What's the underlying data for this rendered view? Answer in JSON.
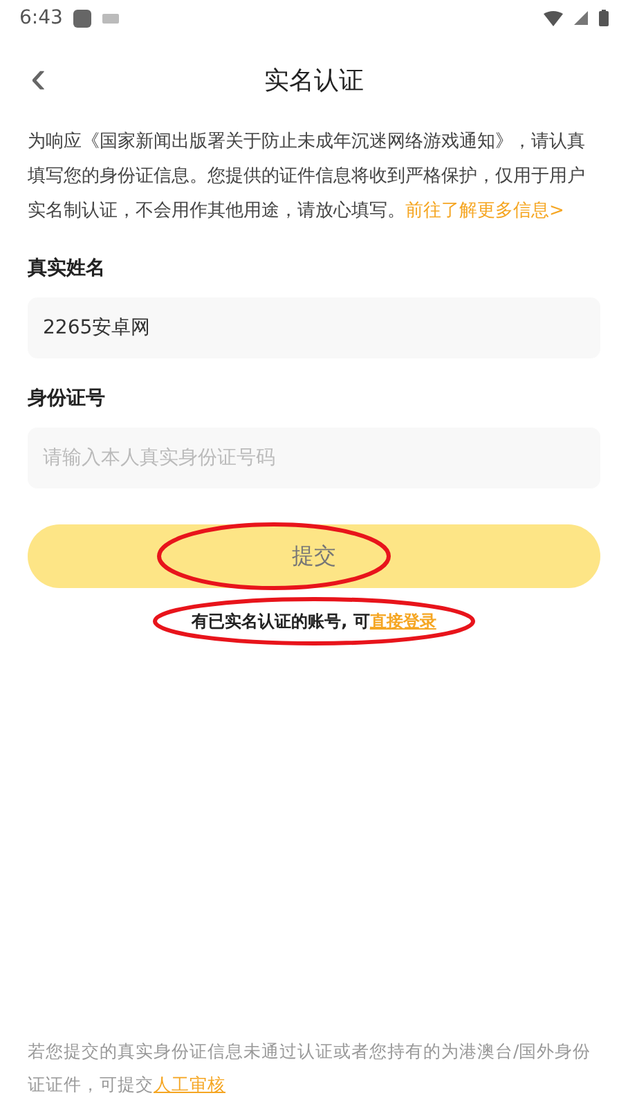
{
  "status_bar": {
    "time": "6:43"
  },
  "header": {
    "back": "‹",
    "title": "实名认证"
  },
  "notice": {
    "text": "为响应《国家新闻出版署关于防止未成年沉迷网络游戏通知》，请认真填写您的身份证信息。您提供的证件信息将收到严格保护，仅用于用户实名制认证，不会用作其他用途，请放心填写。",
    "link": "前往了解更多信息>"
  },
  "fields": [
    {
      "label": "真实姓名",
      "value": "2265安卓网"
    },
    {
      "label": "身份证号",
      "placeholder": "请输入本人真实身份证号码"
    }
  ],
  "submit_button": {
    "label": "提交",
    "circled": true
  },
  "login_hint": {
    "text": "有已实名认证的账号, 可",
    "link": "直接登录",
    "circled": true
  },
  "footer": {
    "text": "若您提交的真实身份证信息未通过认证或者您持有的为港澳台/国外身份证证件，可提交",
    "link": "人工审核"
  }
}
